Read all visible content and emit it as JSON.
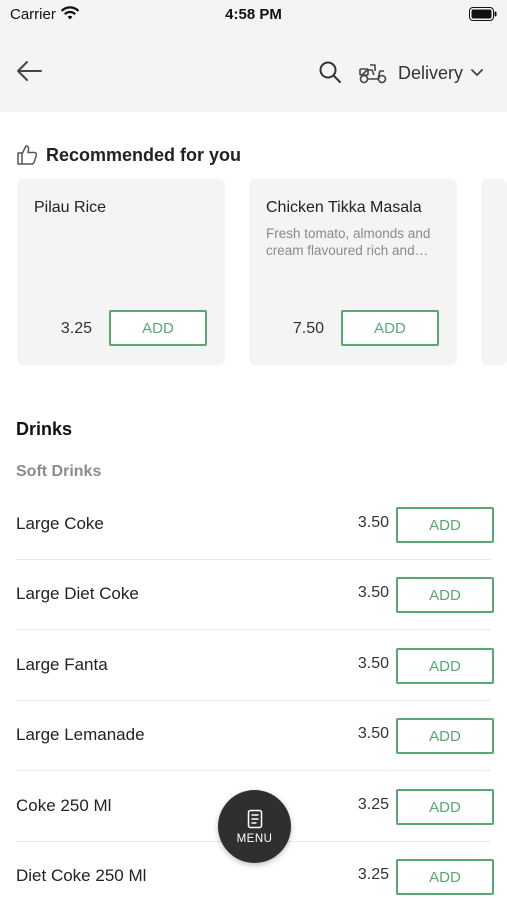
{
  "status_bar": {
    "carrier": "Carrier",
    "time": "4:58 PM"
  },
  "header": {
    "delivery_label": "Delivery"
  },
  "recommended": {
    "title": "Recommended for you",
    "items": [
      {
        "name": "Pilau Rice",
        "description": "",
        "price": "3.25",
        "add_label": "ADD"
      },
      {
        "name": "Chicken Tikka Masala",
        "description": "Fresh tomato, almonds and cream flavoured rich and…",
        "price": "7.50",
        "add_label": "ADD"
      }
    ]
  },
  "menu": {
    "section_title": "Drinks",
    "subsection_title": "Soft Drinks",
    "items": [
      {
        "name": "Large Coke",
        "price": "3.50",
        "add_label": "ADD"
      },
      {
        "name": "Large Diet Coke",
        "price": "3.50",
        "add_label": "ADD"
      },
      {
        "name": "Large Fanta",
        "price": "3.50",
        "add_label": "ADD"
      },
      {
        "name": "Large Lemanade",
        "price": "3.50",
        "add_label": "ADD"
      },
      {
        "name": "Coke 250 Ml",
        "price": "3.25",
        "add_label": "ADD"
      },
      {
        "name": "Diet Coke 250 Ml",
        "price": "3.25",
        "add_label": "ADD"
      }
    ]
  },
  "fab": {
    "label": "MENU"
  },
  "colors": {
    "accent": "#5aa774",
    "header_bg": "#f4f4f4",
    "fab_bg": "#2f2f2f"
  },
  "icons": [
    "wifi-icon",
    "battery-icon",
    "back-arrow-icon",
    "search-icon",
    "scooter-icon",
    "chevron-down-icon",
    "thumbs-up-icon",
    "menu-book-icon"
  ]
}
